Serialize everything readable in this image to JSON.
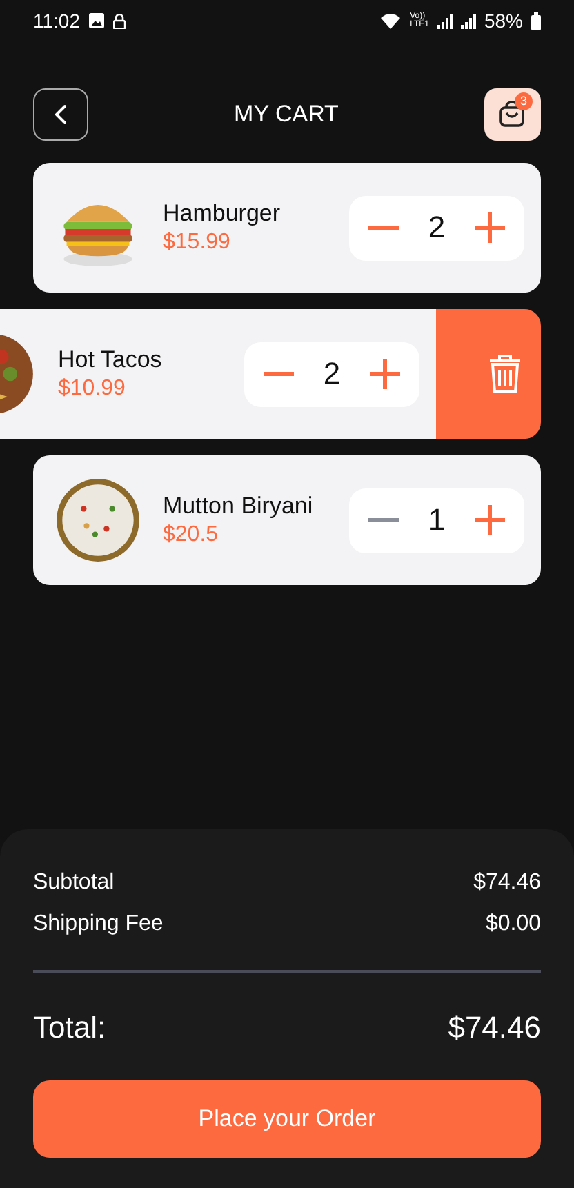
{
  "status_bar": {
    "time": "11:02",
    "volte": [
      "Vo))",
      "LTE1"
    ],
    "battery": "58%"
  },
  "header": {
    "title": "MY CART",
    "cart_count": "3"
  },
  "items": [
    {
      "name": "Hamburger",
      "price": "$15.99",
      "quantity": "2",
      "minus_disabled": false,
      "swiped": false
    },
    {
      "name": "Hot Tacos",
      "price": "$10.99",
      "quantity": "2",
      "minus_disabled": false,
      "swiped": true
    },
    {
      "name": "Mutton Biryani",
      "price": "$20.5",
      "quantity": "1",
      "minus_disabled": true,
      "swiped": false
    }
  ],
  "summary": {
    "rows": [
      {
        "label": "Subtotal",
        "value": "$74.46"
      },
      {
        "label": "Shipping Fee",
        "value": "$0.00"
      }
    ],
    "total_label": "Total:",
    "total_value": "$74.46"
  },
  "order_button": "Place your Order"
}
